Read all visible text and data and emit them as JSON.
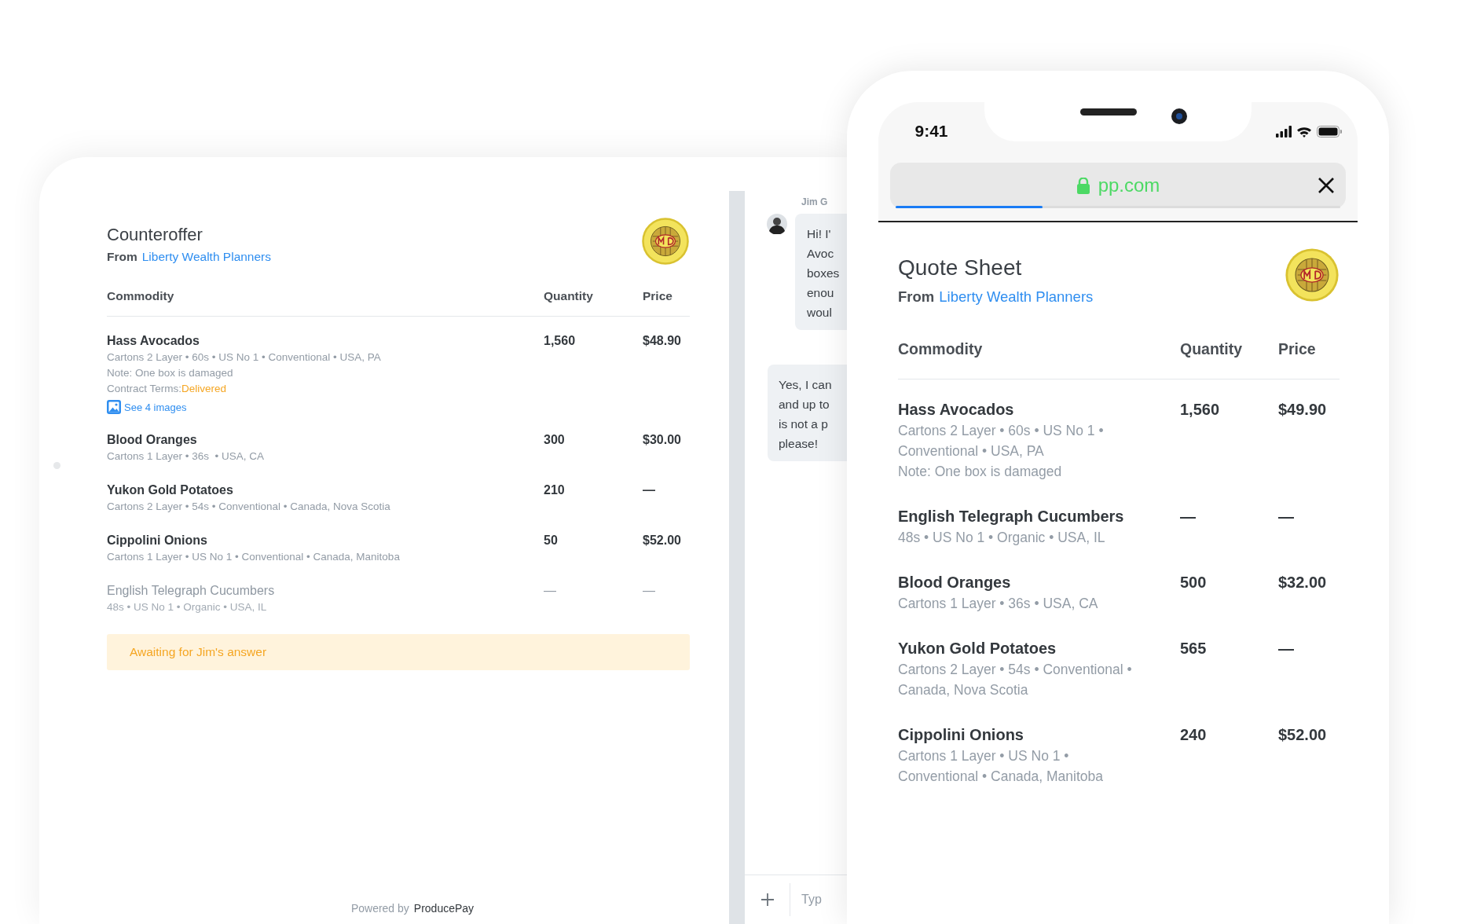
{
  "counteroffer": {
    "title": "Counteroffer",
    "from_label": "From",
    "from_name": "Liberty Wealth Planners",
    "columns": [
      "Commodity",
      "Quantity",
      "Price"
    ],
    "rows": [
      {
        "name": "Hass Avocados",
        "details": "Cartons 2 Layer • 60s • US No 1 • Conventional • USA, PA",
        "note": "Note: One box is damaged",
        "terms_label": "Contract Terms:",
        "terms_value": "Delivered",
        "images_link": "See 4 images",
        "quantity": "1,560",
        "price": "$48.90",
        "disabled": false
      },
      {
        "name": "Blood Oranges",
        "details": "Cartons 1 Layer • 36s  • USA, CA",
        "quantity": "300",
        "price": "$30.00",
        "disabled": false
      },
      {
        "name": "Yukon Gold Potatoes",
        "details": "Cartons 2 Layer • 54s • Conventional • Canada, Nova Scotia",
        "quantity": "210",
        "price": "—",
        "disabled": false
      },
      {
        "name": "Cippolini Onions",
        "details": "Cartons 1 Layer • US No 1 • Conventional • Canada, Manitoba",
        "quantity": "50",
        "price": "$52.00",
        "disabled": false
      },
      {
        "name": "English Telegraph Cucumbers",
        "details": "48s • US No 1 • Organic • USA, IL",
        "quantity": "—",
        "price": "—",
        "disabled": true
      }
    ],
    "status": "Awaiting for Jim's answer",
    "footer": {
      "label": "Powered by",
      "brand": "ProducePay"
    }
  },
  "chat": {
    "sender": "Jim G",
    "messages": [
      {
        "kind": "received",
        "text": "Hi! I'\nAvoc\nboxes\nenou\nwoul"
      },
      {
        "kind": "sent",
        "text": "Yes, I can\nand up to\nis not a p\nplease!"
      }
    ],
    "composer": {
      "placeholder": "Typ"
    }
  },
  "phone": {
    "status_bar": {
      "time": "9:41"
    },
    "address_bar": {
      "url": "pp.com",
      "level": 0.33
    },
    "quote_sheet": {
      "title": "Quote Sheet",
      "from_label": "From",
      "from_name": "Liberty Wealth Planners",
      "columns": [
        "Commodity",
        "Quantity",
        "Price"
      ],
      "rows": [
        {
          "name": "Hass Avocados",
          "details": "Cartons 2 Layer • 60s • US No 1 • Conventional • USA, PA",
          "note": "Note: One box is damaged",
          "quantity": "1,560",
          "price": "$49.90",
          "disabled": false
        },
        {
          "name": "English Telegraph Cucumbers",
          "details": "48s • US No 1 • Organic • USA, IL",
          "quantity": "—",
          "price": "—",
          "disabled": false
        },
        {
          "name": "Blood Oranges",
          "details": "Cartons 1 Layer • 36s  • USA, CA",
          "quantity": "500",
          "price": "$32.00",
          "disabled": false
        },
        {
          "name": "Yukon Gold Potatoes",
          "details": "Cartons 2 Layer • 54s • Conventional • Canada, Nova Scotia",
          "quantity": "565",
          "price": "—",
          "disabled": false
        },
        {
          "name": "Cippolini Onions",
          "details": "Cartons 1 Layer • US No 1 • Conventional • Canada, Manitoba",
          "quantity": "240",
          "price": "$52.00",
          "disabled": false
        }
      ]
    }
  }
}
